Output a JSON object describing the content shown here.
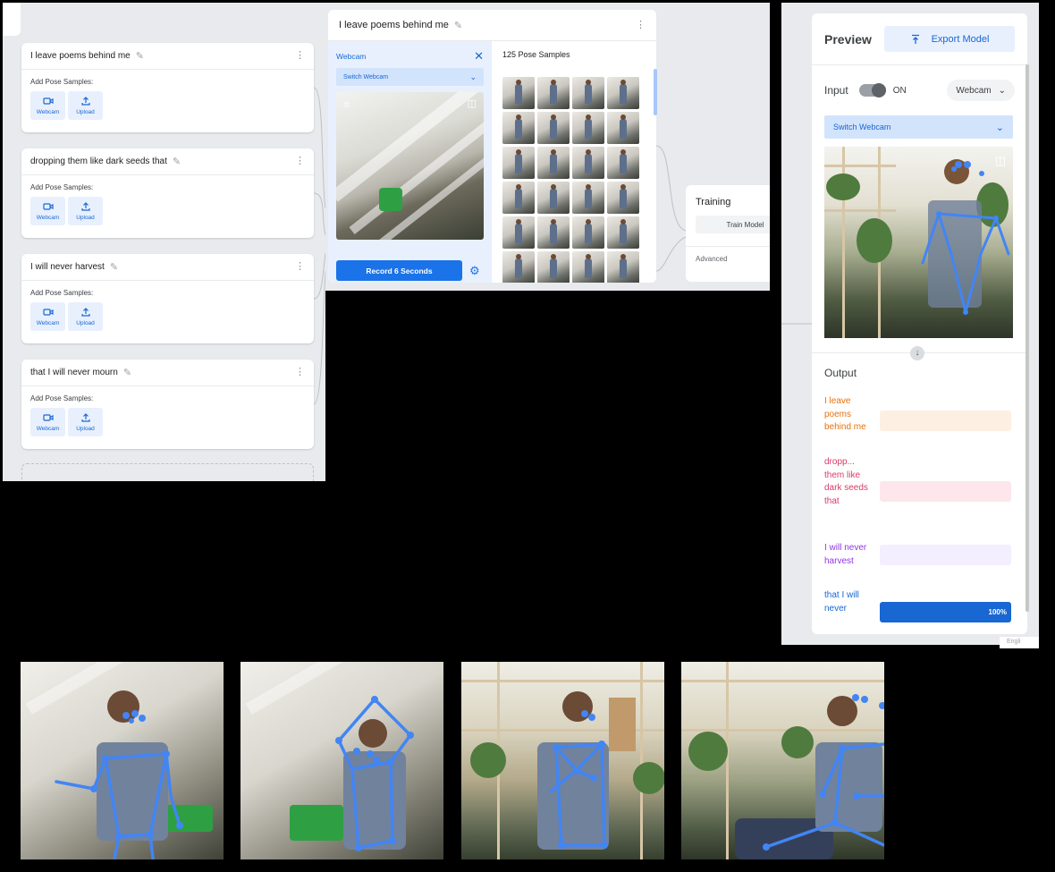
{
  "classes": [
    {
      "name": "I leave poems behind me",
      "add_label": "Add Pose Samples:",
      "webcam_label": "Webcam",
      "upload_label": "Upload"
    },
    {
      "name": "dropping them like dark seeds that",
      "add_label": "Add Pose Samples:",
      "webcam_label": "Webcam",
      "upload_label": "Upload"
    },
    {
      "name": "I will never harvest",
      "add_label": "Add Pose Samples:",
      "webcam_label": "Webcam",
      "upload_label": "Upload"
    },
    {
      "name": "that I will never mourn",
      "add_label": "Add Pose Samples:",
      "webcam_label": "Webcam",
      "upload_label": "Upload"
    }
  ],
  "capture": {
    "title": "I leave poems behind me",
    "source_label": "Webcam",
    "switch_label": "Switch Webcam",
    "record_label": "Record 6 Seconds",
    "samples_label": "125 Pose Samples"
  },
  "training": {
    "title": "Training",
    "train_label": "Train Model",
    "advanced_label": "Advanced"
  },
  "preview": {
    "title": "Preview",
    "export_label": "Export Model",
    "input_label": "Input",
    "toggle_state": "ON",
    "source": "Webcam",
    "switch_label": "Switch Webcam",
    "output_title": "Output",
    "outputs": [
      {
        "label": "I leave poems behind me",
        "confidence": 0,
        "color": "#e8710a",
        "track": "#feefe3"
      },
      {
        "label": "dropp... them like dark seeds that",
        "confidence": 0,
        "color": "#d93b68",
        "track": "#fde7ec"
      },
      {
        "label": "I will never harvest",
        "confidence": 0,
        "color": "#9334e6",
        "track": "#f3efff"
      },
      {
        "label": "that I will never",
        "confidence": 1.0,
        "percent_text": "100%",
        "color": "#1967d2",
        "track": "#1967d2"
      }
    ]
  },
  "footer": {
    "language_stub": "Engli"
  },
  "colors": {
    "accent": "#1a73e8",
    "skeleton": "#4285f4"
  }
}
